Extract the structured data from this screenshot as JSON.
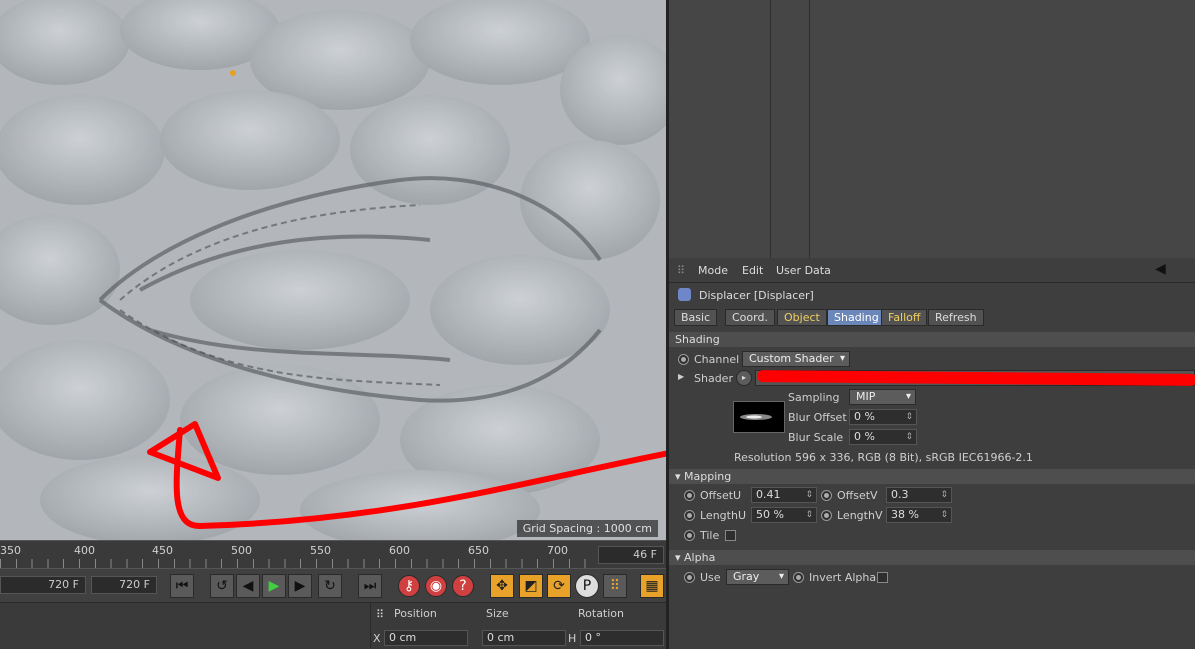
{
  "viewport": {
    "grid_spacing": "Grid Spacing : 1000 cm"
  },
  "timeline": {
    "ticks": [
      "350",
      "400",
      "450",
      "500",
      "550",
      "600",
      "650",
      "700"
    ],
    "current_frame": "46 F",
    "start_field": "720 F",
    "end_field": "720 F"
  },
  "coords": {
    "position_label": "Position",
    "size_label": "Size",
    "rotation_label": "Rotation",
    "x_label": "X",
    "x_value": "0 cm",
    "size_x_value": "0 cm",
    "h_label": "H",
    "h_value": "0 °"
  },
  "attr": {
    "menu": [
      "Mode",
      "Edit",
      "User Data"
    ],
    "object_title": "Displacer [Displacer]",
    "tabs": [
      "Basic",
      "Coord.",
      "Object",
      "Shading",
      "Falloff",
      "Refresh"
    ],
    "shading_section": "Shading",
    "channel_label": "Channel",
    "channel_value": "Custom Shader",
    "shader_label": "Shader",
    "sampling_label": "Sampling",
    "sampling_value": "MIP",
    "blur_offset_label": "Blur Offset",
    "blur_offset_value": "0 %",
    "blur_scale_label": "Blur Scale",
    "blur_scale_value": "0 %",
    "resolution": "Resolution 596 x 336, RGB (8 Bit), sRGB IEC61966-2.1",
    "mapping_section": "Mapping",
    "offsetu_label": "OffsetU",
    "offsetu_value": "0.41",
    "offsetv_label": "OffsetV",
    "offsetv_value": "0.3",
    "lengthu_label": "LengthU",
    "lengthu_value": "50 %",
    "lengthv_label": "LengthV",
    "lengthv_value": "38 %",
    "tile_label": "Tile",
    "alpha_section": "Alpha",
    "use_label": "Use",
    "use_value": "Gray",
    "invert_alpha_label": "Invert Alpha"
  },
  "colors": {
    "accent_tab": "#6b86b8",
    "annotation_red": "#ff0000",
    "selected_yellow": "#f0d060"
  }
}
